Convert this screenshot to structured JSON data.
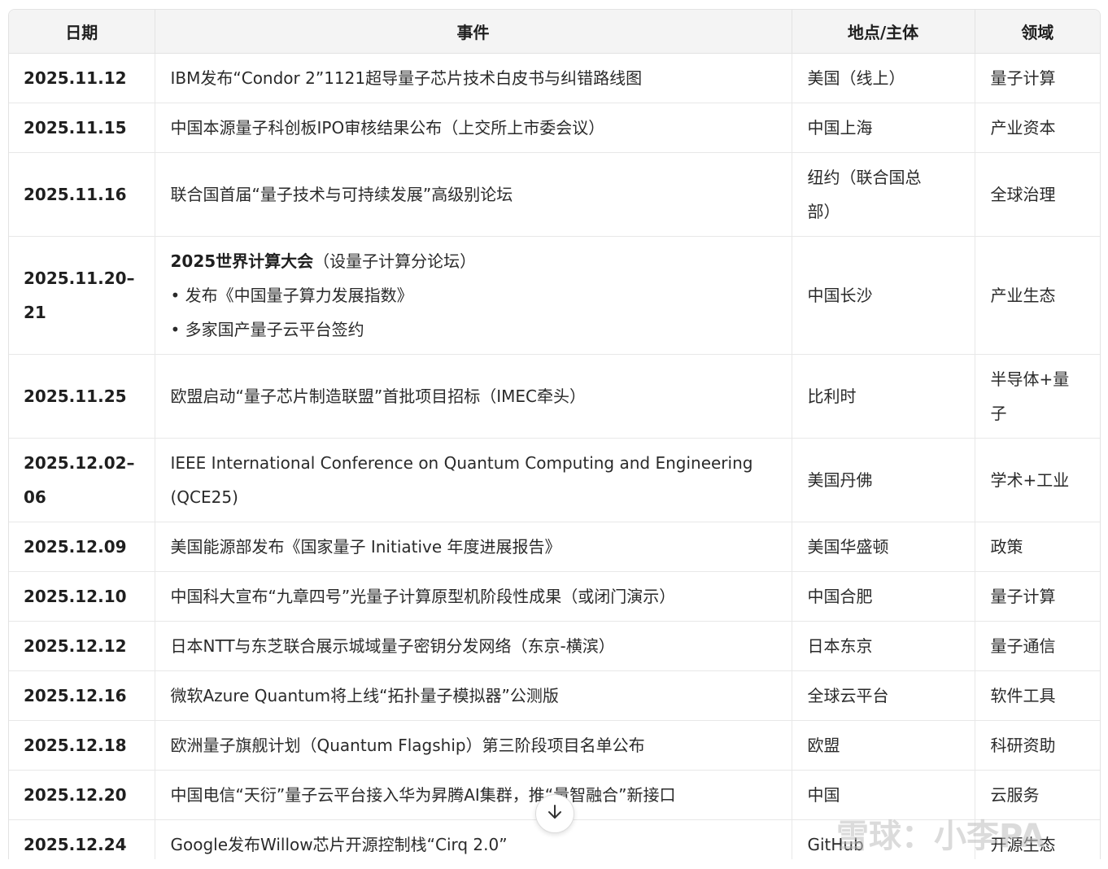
{
  "table": {
    "headers": [
      "日期",
      "事件",
      "地点/主体",
      "领域"
    ],
    "rows": [
      {
        "date": "2025.11.12",
        "event": "IBM发布“Condor 2”1121超导量子芯片技术白皮书与纠错路线图",
        "place": "美国（线上）",
        "field": "量子计算"
      },
      {
        "date": "2025.11.15",
        "event": "中国本源量子科创板IPO审核结果公布（上交所上市委会议）",
        "place": "中国上海",
        "field": "产业资本"
      },
      {
        "date": "2025.11.16",
        "event": "联合国首届“量子技术与可持续发展”高级别论坛",
        "place_l1": "纽约（联合国总",
        "place_l2": "部）",
        "field": "全球治理"
      },
      {
        "date": "2025.11.20–21",
        "event_bold": "2025世界计算大会",
        "event_rest": "（设量子计算分论坛）",
        "event_l2": "• 发布《中国量子算力发展指数》",
        "event_l3": "• 多家国产量子云平台签约",
        "place": "中国长沙",
        "field": "产业生态"
      },
      {
        "date": "2025.11.25",
        "event": "欧盟启动“量子芯片制造联盟”首批项目招标（IMEC牵头）",
        "place": "比利时",
        "field_l1": "半导体+量",
        "field_l2": "子"
      },
      {
        "date_l1": "2025.12.02–",
        "date_l2": "06",
        "event_l1": "IEEE International Conference on Quantum Computing and Engineering",
        "event_l2": "(QCE25)",
        "place": "美国丹佛",
        "field": "学术+工业"
      },
      {
        "date": "2025.12.09",
        "event": "美国能源部发布《国家量子 Initiative 年度进展报告》",
        "place": "美国华盛顿",
        "field": "政策"
      },
      {
        "date": "2025.12.10",
        "event": "中国科大宣布“九章四号”光量子计算原型机阶段性成果（或闭门演示）",
        "place": "中国合肥",
        "field": "量子计算"
      },
      {
        "date": "2025.12.12",
        "event": "日本NTT与东芝联合展示城域量子密钥分发网络（东京-横滨）",
        "place": "日本东京",
        "field": "量子通信"
      },
      {
        "date": "2025.12.16",
        "event": "微软Azure Quantum将上线“拓扑量子模拟器”公测版",
        "place": "全球云平台",
        "field": "软件工具"
      },
      {
        "date": "2025.12.18",
        "event": "欧洲量子旗舰计划（Quantum Flagship）第三阶段项目名单公布",
        "place": "欧盟",
        "field": "科研资助"
      },
      {
        "date": "2025.12.20",
        "event": "中国电信“天衍”量子云平台接入华为昇腾AI集群，推“量智融合”新接口",
        "place": "中国",
        "field": "云服务"
      },
      {
        "date": "2025.12.24",
        "event": "Google发布Willow芯片开源控制栈“Cirq 2.0”",
        "place": "GitHub",
        "field": "开源生态"
      }
    ]
  },
  "scroll_button": {
    "icon": "arrow-down-icon"
  },
  "watermark": {
    "text": "雪球：小李PA"
  }
}
